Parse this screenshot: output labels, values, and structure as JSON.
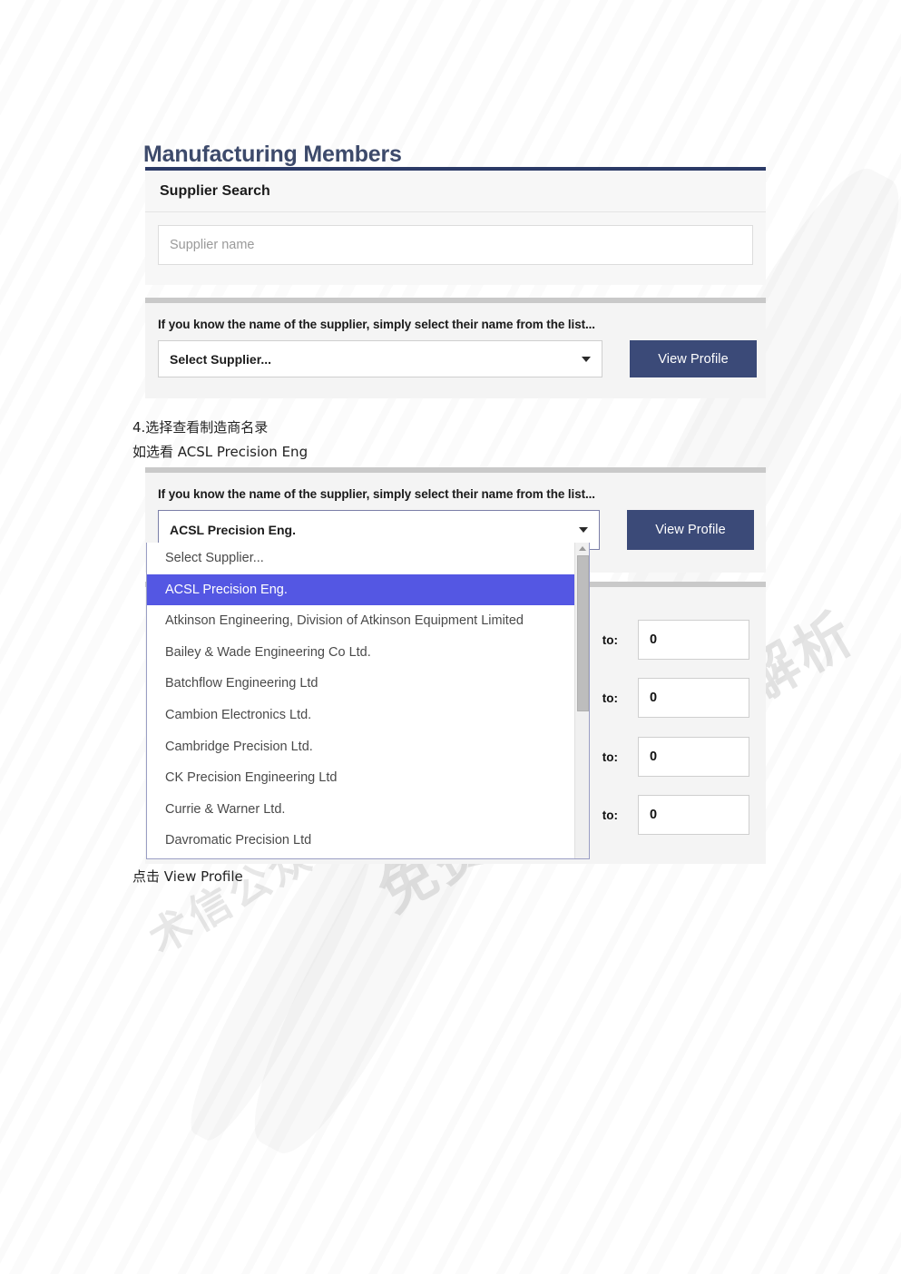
{
  "page": {
    "title": "Manufacturing Members"
  },
  "search_card": {
    "header": "Supplier Search",
    "input_placeholder": "Supplier name",
    "input_value": ""
  },
  "panel_collapsed": {
    "label": "If you know the name of the supplier, simply select their name from the list...",
    "select_value": "Select Supplier...",
    "button_label": "View Profile",
    "caret_icon": "chevron-down-icon"
  },
  "panel_open": {
    "label": "If you know the name of the supplier, simply select their name from the list...",
    "select_value": "ACSL Precision Eng.",
    "button_label": "View Profile",
    "caret_icon": "chevron-down-icon",
    "options": [
      {
        "label": "Select Supplier...",
        "selected": false
      },
      {
        "label": "ACSL Precision Eng.",
        "selected": true
      },
      {
        "label": "Atkinson Engineering, Division of Atkinson Equipment Limited",
        "selected": false
      },
      {
        "label": "Bailey & Wade Engineering Co Ltd.",
        "selected": false
      },
      {
        "label": "Batchflow Engineering Ltd",
        "selected": false
      },
      {
        "label": "Cambion Electronics Ltd.",
        "selected": false
      },
      {
        "label": "Cambridge Precision Ltd.",
        "selected": false
      },
      {
        "label": "CK Precision Engineering Ltd",
        "selected": false
      },
      {
        "label": "Currie & Warner Ltd.",
        "selected": false
      },
      {
        "label": "Davromatic Precision Ltd",
        "selected": false
      }
    ]
  },
  "numeric_panel": {
    "rows": [
      {
        "label": "to:",
        "value": "0"
      },
      {
        "label": "to:",
        "value": "0"
      },
      {
        "label": "to:",
        "value": "0"
      },
      {
        "label": "to:",
        "value": "0"
      }
    ]
  },
  "annotations": {
    "line1": "4.选择查看制造商名录",
    "line2": "如选看 ACSL Precision Eng",
    "line3": "点击 View Profile"
  },
  "watermark": {
    "text_1": "免费查看完整版解析",
    "text_2": "术信公众号"
  },
  "colors": {
    "title": "#3d4a6b",
    "card_top_border": "#2b3a66",
    "button": "#3b4a78",
    "highlight": "#5457e3",
    "panel_bg": "#f4f4f4",
    "panel_top_border": "#c9c9c9"
  }
}
